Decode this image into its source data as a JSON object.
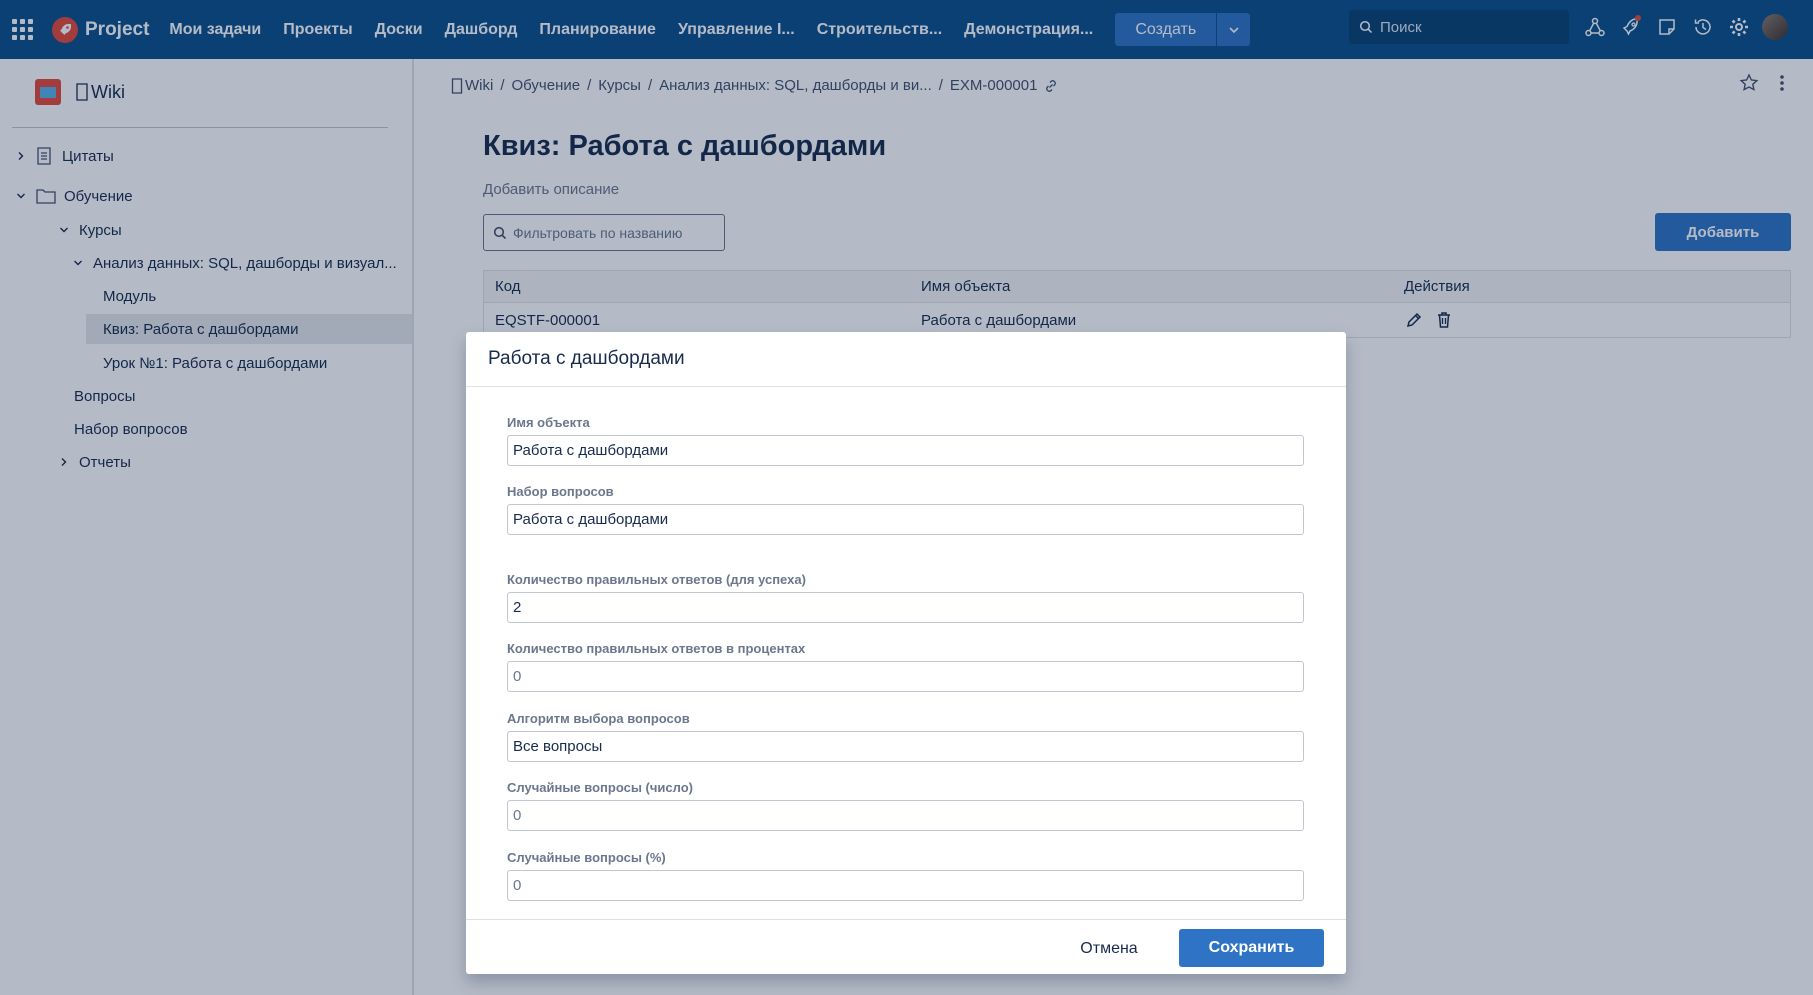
{
  "topbar": {
    "logo_text": "Project",
    "nav": [
      "Мои задачи",
      "Проекты",
      "Доски",
      "Дашборд",
      "Планирование",
      "Управление I...",
      "Строительств...",
      "Демонстрация..."
    ],
    "create_label": "Создать",
    "search_placeholder": "Поиск",
    "icons": [
      "apps-grid-icon",
      "rocket-logo-icon",
      "hierarchy-icon",
      "rocket-notification-icon",
      "note-icon",
      "history-icon",
      "gear-icon",
      "avatar"
    ],
    "accent_color": "#0b4f8a"
  },
  "sidebar": {
    "space_title": "Wiki",
    "items": [
      {
        "label": "Цитаты"
      },
      {
        "label": "Обучение"
      },
      {
        "label": "Курсы"
      },
      {
        "label": "Анализ данных: SQL, дашборды и визуал..."
      },
      {
        "label": "Модуль"
      },
      {
        "label": "Квиз: Работа с дашбордами"
      },
      {
        "label": "Урок №1: Работа с дашбордами"
      },
      {
        "label": "Вопросы"
      },
      {
        "label": "Набор вопросов"
      },
      {
        "label": "Отчеты"
      }
    ]
  },
  "main": {
    "breadcrumb": [
      "Wiki",
      "Обучение",
      "Курсы",
      "Анализ данных: SQL, дашборды и ви...",
      "EXM-000001"
    ],
    "title": "Квиз: Работа с дашбордами",
    "description_placeholder": "Добавить описание",
    "filter_placeholder": "Фильтровать по названию",
    "add_label": "Добавить",
    "table": {
      "columns": [
        "Код",
        "Имя объекта",
        "Действия"
      ],
      "rows": [
        {
          "code": "EQSTF-000001",
          "name": "Работа с дашбордами"
        }
      ]
    }
  },
  "modal": {
    "title": "Работа с дашбордами",
    "fields": [
      {
        "label": "Имя объекта",
        "value": "Работа с дашбордами",
        "placeholder": ""
      },
      {
        "label": "Набор вопросов",
        "value": "Работа с дашбордами",
        "placeholder": ""
      },
      {
        "label": "Количество правильных ответов (для успеха)",
        "value": "2",
        "placeholder": ""
      },
      {
        "label": "Количество правильных ответов в процентах",
        "value": "",
        "placeholder": "0"
      },
      {
        "label": "Алгоритм выбора вопросов",
        "value": "Все вопросы",
        "placeholder": ""
      },
      {
        "label": "Случайные вопросы (число)",
        "value": "",
        "placeholder": "0"
      },
      {
        "label": "Случайные вопросы (%)",
        "value": "",
        "placeholder": "0"
      }
    ],
    "cancel_label": "Отмена",
    "save_label": "Сохранить"
  }
}
